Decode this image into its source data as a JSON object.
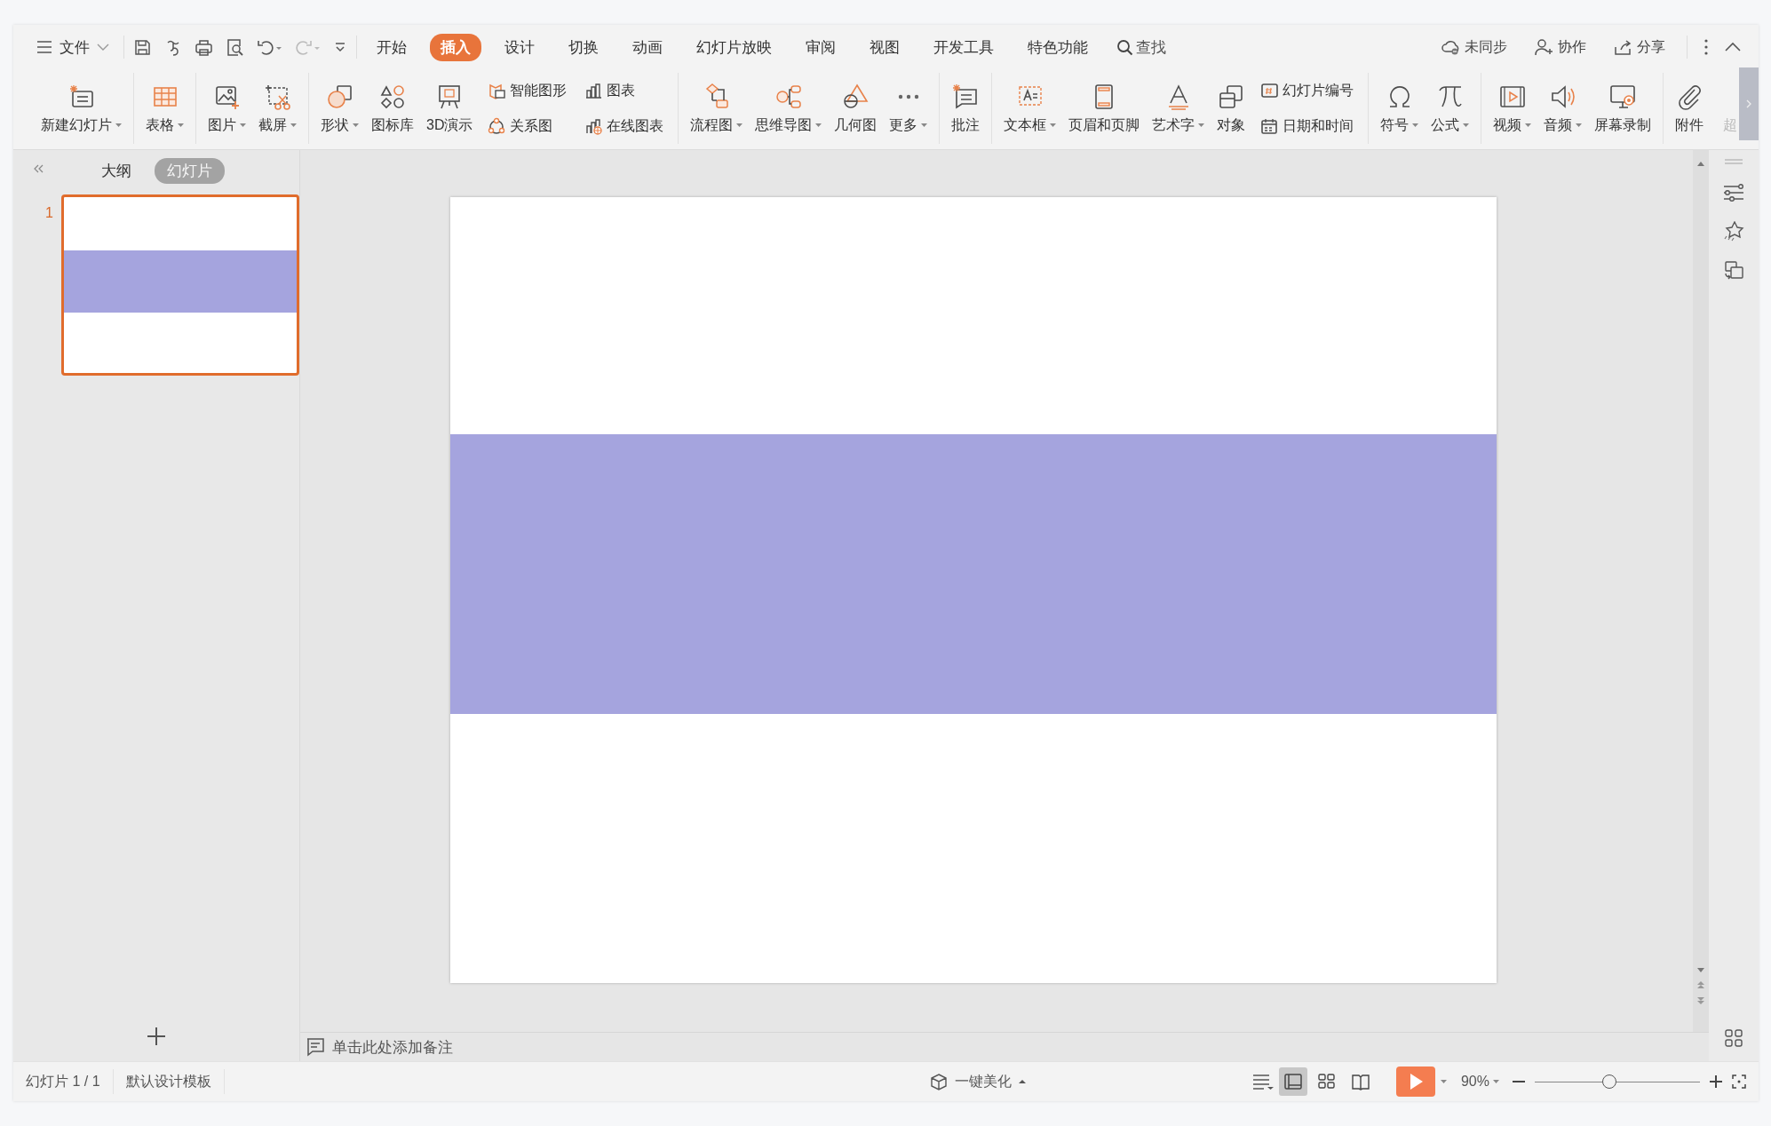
{
  "menu": {
    "file_label": "文件",
    "tabs": [
      {
        "label": "开始",
        "selected": false
      },
      {
        "label": "插入",
        "selected": true
      },
      {
        "label": "设计",
        "selected": false
      },
      {
        "label": "切换",
        "selected": false
      },
      {
        "label": "动画",
        "selected": false
      },
      {
        "label": "幻灯片放映",
        "selected": false
      },
      {
        "label": "审阅",
        "selected": false
      },
      {
        "label": "视图",
        "selected": false
      },
      {
        "label": "开发工具",
        "selected": false
      },
      {
        "label": "特色功能",
        "selected": false
      }
    ],
    "search_label": "查找",
    "actions": [
      "未同步",
      "协作",
      "分享"
    ]
  },
  "ribbon": {
    "groups": [
      [
        {
          "kind": "large",
          "label": "新建幻灯片",
          "dropdown": true
        }
      ],
      [
        {
          "kind": "large",
          "label": "表格",
          "dropdown": true
        }
      ],
      [
        {
          "kind": "large",
          "label": "图片",
          "dropdown": true
        },
        {
          "kind": "large",
          "label": "截屏",
          "dropdown": true
        }
      ],
      [
        {
          "kind": "large",
          "label": "形状",
          "dropdown": true
        },
        {
          "kind": "large",
          "label": "图标库",
          "dropdown": false
        },
        {
          "kind": "large",
          "label": "3D演示",
          "dropdown": false
        },
        {
          "kind": "stack",
          "items": [
            {
              "label": "智能图形"
            },
            {
              "label": "关系图"
            }
          ]
        },
        {
          "kind": "stack",
          "items": [
            {
              "label": "图表"
            },
            {
              "label": "在线图表"
            }
          ]
        }
      ],
      [
        {
          "kind": "large",
          "label": "流程图",
          "dropdown": true
        },
        {
          "kind": "large",
          "label": "思维导图",
          "dropdown": true
        },
        {
          "kind": "large",
          "label": "几何图",
          "dropdown": false
        },
        {
          "kind": "large",
          "label": "更多",
          "dropdown": true
        }
      ],
      [
        {
          "kind": "large",
          "label": "批注",
          "dropdown": false
        }
      ],
      [
        {
          "kind": "large",
          "label": "文本框",
          "dropdown": true
        },
        {
          "kind": "large",
          "label": "页眉和页脚",
          "dropdown": false
        },
        {
          "kind": "large",
          "label": "艺术字",
          "dropdown": true
        },
        {
          "kind": "large",
          "label": "对象",
          "dropdown": false
        },
        {
          "kind": "stack",
          "items": [
            {
              "label": "幻灯片编号"
            },
            {
              "label": "日期和时间"
            }
          ]
        }
      ],
      [
        {
          "kind": "large",
          "label": "符号",
          "dropdown": true
        },
        {
          "kind": "large",
          "label": "公式",
          "dropdown": true
        }
      ],
      [
        {
          "kind": "large",
          "label": "视频",
          "dropdown": true
        },
        {
          "kind": "large",
          "label": "音频",
          "dropdown": true
        },
        {
          "kind": "large",
          "label": "屏幕录制",
          "dropdown": false
        }
      ],
      [
        {
          "kind": "large",
          "label": "附件",
          "dropdown": false
        },
        {
          "kind": "large",
          "label": "超",
          "dropdown": false
        }
      ]
    ]
  },
  "slides_panel": {
    "tabs": [
      {
        "label": "大纲",
        "selected": false
      },
      {
        "label": "幻灯片",
        "selected": true
      }
    ],
    "thumbnails": [
      {
        "number": "1",
        "selected": true
      }
    ]
  },
  "notes": {
    "placeholder": "单击此处添加备注"
  },
  "status_bar": {
    "slide_counter": "幻灯片 1 / 1",
    "template": "默认设计模板",
    "beautify": "一键美化",
    "view_buttons": [
      {
        "selected": true
      },
      {
        "selected": false
      },
      {
        "selected": false
      }
    ],
    "zoom": {
      "value": "90%",
      "level": 0.45
    }
  }
}
